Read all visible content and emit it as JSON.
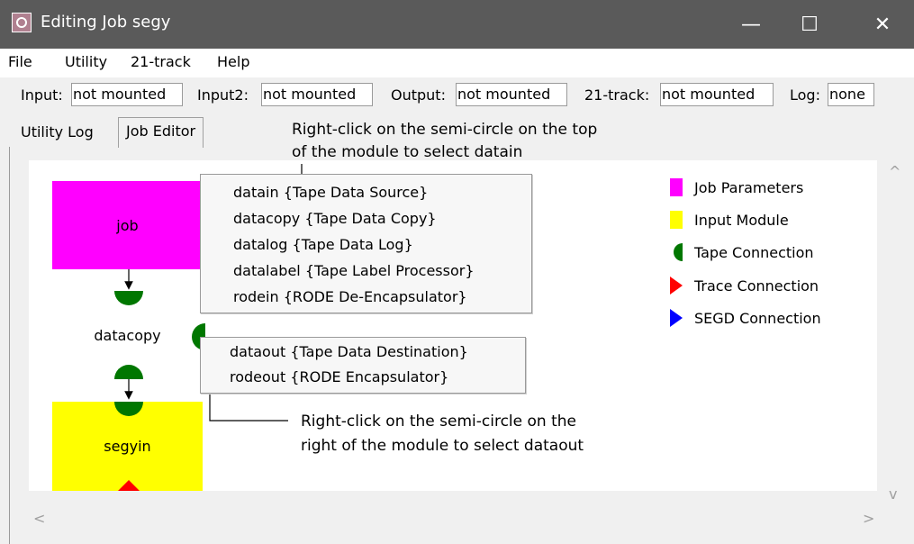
{
  "window": {
    "title": "Editing Job segy"
  },
  "window_controls": {
    "minimize": "—",
    "maximize": "☐",
    "close": "✕"
  },
  "menu": {
    "items": [
      "File",
      "Utility",
      "21-track",
      "Help"
    ]
  },
  "status": {
    "input_label": "Input:",
    "input_value": "not mounted",
    "input2_label": "Input2:",
    "input2_value": "not mounted",
    "output_label": "Output:",
    "output_value": "not mounted",
    "track21_label": "21-track:",
    "track21_value": "not mounted",
    "log_label": "Log:",
    "log_value": "none"
  },
  "tabs": [
    {
      "label": "Utility Log",
      "active": false
    },
    {
      "label": "Job Editor",
      "active": true
    }
  ],
  "modules": [
    {
      "label": "job",
      "color": "#ff00ff"
    },
    {
      "label": "datacopy",
      "color": "#ffffff"
    },
    {
      "label": "segyin",
      "color": "#ffff00"
    }
  ],
  "datain_menu": {
    "items": [
      "datain {Tape Data Source}",
      "datacopy {Tape Data Copy}",
      "datalog {Tape Data Log}",
      "datalabel {Tape Label Processor}",
      "rodein {RODE De-Encapsulator}"
    ]
  },
  "dataout_menu": {
    "items": [
      "dataout {Tape Data Destination}",
      "rodeout {RODE Encapsulator}"
    ]
  },
  "notes": {
    "top_line1": "Right-click on the semi-circle on the top",
    "top_line2": "of the module to select datain",
    "right_line1": "Right-click on the semi-circle on the",
    "right_line2": "right of the module to select dataout"
  },
  "legend": [
    {
      "label": "Job Parameters",
      "color": "#ff00ff",
      "icon": "square"
    },
    {
      "label": "Input Module",
      "color": "#ffff00",
      "icon": "square"
    },
    {
      "label": "Tape Connection",
      "color": "#007700",
      "icon": "half-circle"
    },
    {
      "label": "Trace Connection",
      "color": "#ff0000",
      "icon": "triangle"
    },
    {
      "label": "SEGD Connection",
      "color": "#0000ff",
      "icon": "triangle"
    }
  ],
  "scroll": {
    "up": "^",
    "down": "v",
    "left": "<",
    "right": ">"
  }
}
